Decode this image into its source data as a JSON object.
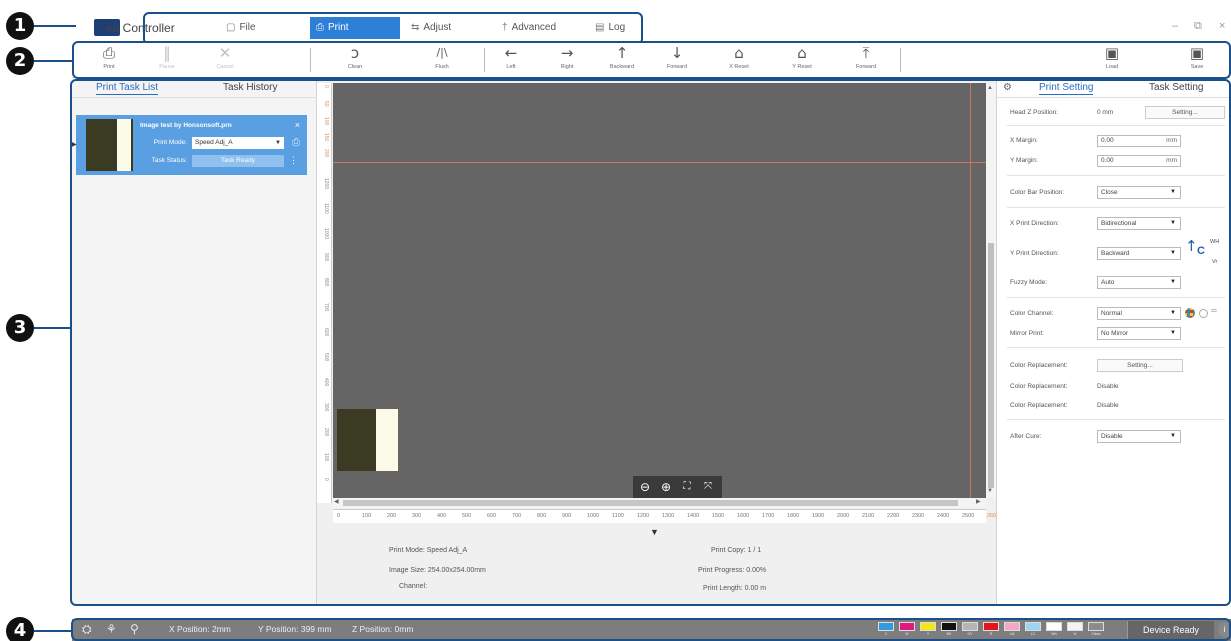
{
  "callouts": [
    "1",
    "2",
    "3",
    "4"
  ],
  "app": {
    "title": "ed Controller"
  },
  "menu": [
    {
      "label": "File",
      "icon": "file-icon",
      "glyph": "▢"
    },
    {
      "label": "Print",
      "icon": "print-icon",
      "glyph": "⎙"
    },
    {
      "label": "Adjust",
      "icon": "adjust-icon",
      "glyph": "⇆"
    },
    {
      "label": "Advanced",
      "icon": "advanced-icon",
      "glyph": "†"
    },
    {
      "label": "Log",
      "icon": "log-icon",
      "glyph": "▤"
    }
  ],
  "window_controls": {
    "minimize": "–",
    "restore": "⧉",
    "close": "×"
  },
  "toolbar": [
    {
      "label": "Print",
      "icon": "printer-icon",
      "glyph": "⎙",
      "enabled": true
    },
    {
      "label": "Pause",
      "icon": "pause-icon",
      "glyph": "‖",
      "enabled": false
    },
    {
      "label": "Cancel",
      "icon": "cancel-icon",
      "glyph": "✕",
      "enabled": false
    },
    {
      "label": "Clean",
      "icon": "clean-icon",
      "glyph": "ↄ",
      "enabled": true
    },
    {
      "label": "Flush",
      "icon": "flush-icon",
      "glyph": "/|\\",
      "enabled": true
    },
    {
      "label": "Left",
      "icon": "arrow-left-icon",
      "glyph": "←",
      "enabled": true
    },
    {
      "label": "Right",
      "icon": "arrow-right-icon",
      "glyph": "→",
      "enabled": true
    },
    {
      "label": "Backward",
      "icon": "arrow-up-icon",
      "glyph": "↑",
      "enabled": true
    },
    {
      "label": "Forward",
      "icon": "arrow-down-icon",
      "glyph": "↓",
      "enabled": true
    },
    {
      "label": "X Reset",
      "icon": "home-x-icon",
      "glyph": "⌂",
      "enabled": true
    },
    {
      "label": "Y Reset",
      "icon": "home-y-icon",
      "glyph": "⌂",
      "enabled": true
    },
    {
      "label": "Forward",
      "icon": "arrow-up-bar-icon",
      "glyph": "⤒",
      "enabled": true
    },
    {
      "label": "Load",
      "icon": "load-icon",
      "glyph": "▣",
      "enabled": true
    },
    {
      "label": "Save",
      "icon": "save-icon",
      "glyph": "▣",
      "enabled": true
    }
  ],
  "left_panel": {
    "tabs": [
      "Print Task List",
      "Task History"
    ],
    "task": {
      "name": "Image test by Honsonsoft.prn",
      "mode_label": "Print Mode:",
      "mode_value": "Speed Adj_A",
      "status_label": "Task Status:",
      "status_value": "Task Ready",
      "close": "×",
      "more": "⋮"
    }
  },
  "canvas": {
    "vruler": [
      "0",
      "50",
      "100",
      "150",
      "200",
      "1200",
      "1100",
      "1000",
      "900",
      "800",
      "700",
      "600",
      "500",
      "400",
      "300",
      "200",
      "100",
      "0"
    ],
    "hruler": [
      "0",
      "100",
      "200",
      "300",
      "400",
      "500",
      "600",
      "700",
      "800",
      "900",
      "1000",
      "1100",
      "1200",
      "1300",
      "1400",
      "1500",
      "1600",
      "1700",
      "1800",
      "1900",
      "2000",
      "2100",
      "2200",
      "2300",
      "2400",
      "2500",
      "2600"
    ],
    "zoom": {
      "zoom_out": "⊖",
      "zoom_in": "⊕",
      "fit": "⛶",
      "actual": "⤧"
    }
  },
  "info": {
    "print_mode": "Print Mode: Speed Adj_A",
    "image_size": "Image Size: 254.00x254.00mm",
    "channel": "Channel:",
    "print_copy": "Print Copy: 1 / 1",
    "print_progress": "Print Progress: 0.00%",
    "print_length": "Print Length: 0.00 m"
  },
  "right_panel": {
    "tabs": [
      "Print Setting",
      "Task Setting"
    ],
    "head_z_label": "Head Z Position:",
    "head_z_value": "0 mm",
    "setting_btn": "Setting...",
    "x_margin_label": "X Margin:",
    "x_margin_value": "0.00",
    "y_margin_label": "Y Margin:",
    "y_margin_value": "0.00",
    "unit_mm": "mm",
    "color_bar_label": "Color Bar Position:",
    "color_bar_value": "Close",
    "x_dir_label": "X Print Direction:",
    "x_dir_value": "Bidirectional",
    "y_dir_label": "Y Print Direction:",
    "y_dir_value": "Backward",
    "fuzzy_label": "Fuzzy Mode:",
    "fuzzy_value": "Auto",
    "channel_label": "Color Channel:",
    "channel_value": "Normal",
    "mirror_label": "Mirror Print:",
    "mirror_value": "No Mirror",
    "color_repl_label": "Color Replacement:",
    "color_repl_btn": "Setting...",
    "color_repl_label2": "Color Replacement:",
    "color_repl_value2": "Disable",
    "color_repl_label3": "Color Replacement:",
    "color_repl_value3": "Disable",
    "after_cure_label": "After Cure:",
    "after_cure_value": "Disable",
    "wh_label": "WH",
    "vr_label": "Vr",
    "c_label": "C"
  },
  "status_bar": {
    "x_position": "X Position: 2mm",
    "y_position": "Y Position: 399 mm",
    "z_position": "Z Position: 0mm",
    "device_status": "Device Ready",
    "inks": [
      {
        "label": "C",
        "color": "#2f9be0"
      },
      {
        "label": "M",
        "color": "#e0197d"
      },
      {
        "label": "Y",
        "color": "#f2e51a"
      },
      {
        "label": "BK",
        "color": "#111111"
      },
      {
        "label": "GY",
        "color": "#b5b5b5"
      },
      {
        "label": "R",
        "color": "#e3141b"
      },
      {
        "label": "LM",
        "color": "#f2a7c8"
      },
      {
        "label": "LC",
        "color": "#9fd3f2"
      },
      {
        "label": "Wh",
        "color": "#ffffff"
      },
      {
        "label": "Vr",
        "color": "#f3f3f3"
      },
      {
        "label": "Clean",
        "color": "#8c8c8c"
      }
    ]
  }
}
